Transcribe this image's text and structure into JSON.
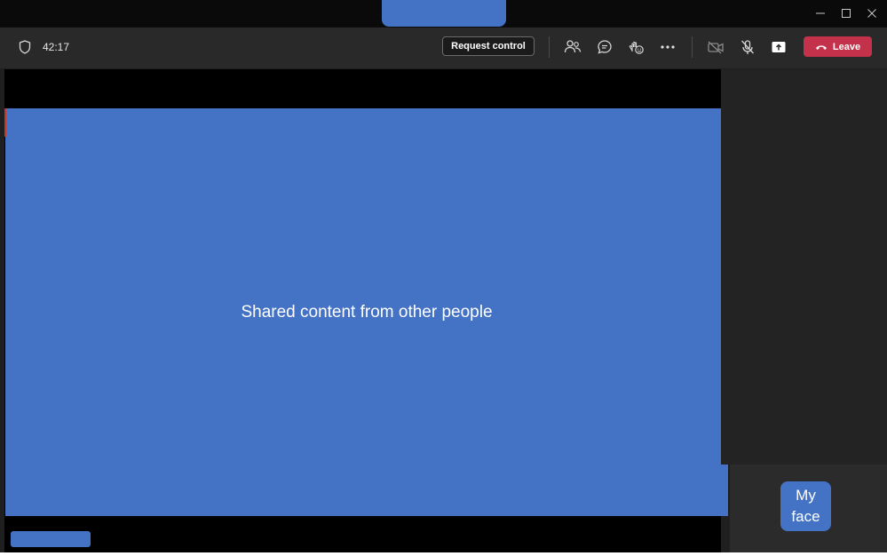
{
  "toolbar": {
    "timer": "42:17",
    "request_control_label": "Request control",
    "leave_label": "Leave",
    "icons": [
      "shield-icon",
      "people-icon",
      "chat-icon",
      "reactions-icon",
      "more-icon",
      "camera-off-icon",
      "mic-off-icon",
      "share-icon",
      "phone-icon"
    ]
  },
  "stage": {
    "shared_content_label": "Shared content from other people"
  },
  "self_view": {
    "label": "My face"
  },
  "colors": {
    "accent_blue": "#4472c4",
    "leave_red": "#c4314b",
    "toolbar_bg": "#292929",
    "stage_bg": "#000000"
  }
}
